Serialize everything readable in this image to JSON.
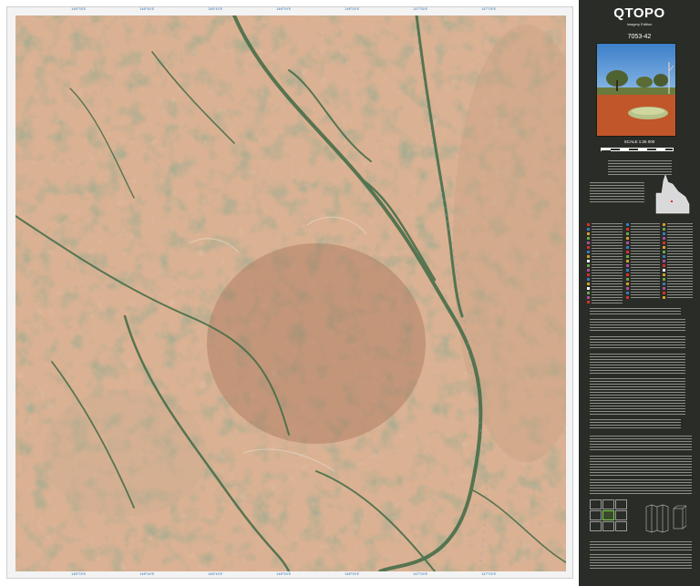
{
  "panel": {
    "brand": "QTOPO",
    "edition": "Imagery Edition",
    "sheet_number": "7053-42",
    "scale": "SCALE 1:25 000"
  },
  "colors": {
    "panel_bg": "#2a2d27",
    "map_frame": "#f3f3f3",
    "grid_text": "#2a6fb0",
    "soil": "#b5704a",
    "vegetation": "#3f6a45"
  },
  "icons": [
    "queensland-outline-icon",
    "scale-bar-icon",
    "folding-diagram-icon"
  ]
}
